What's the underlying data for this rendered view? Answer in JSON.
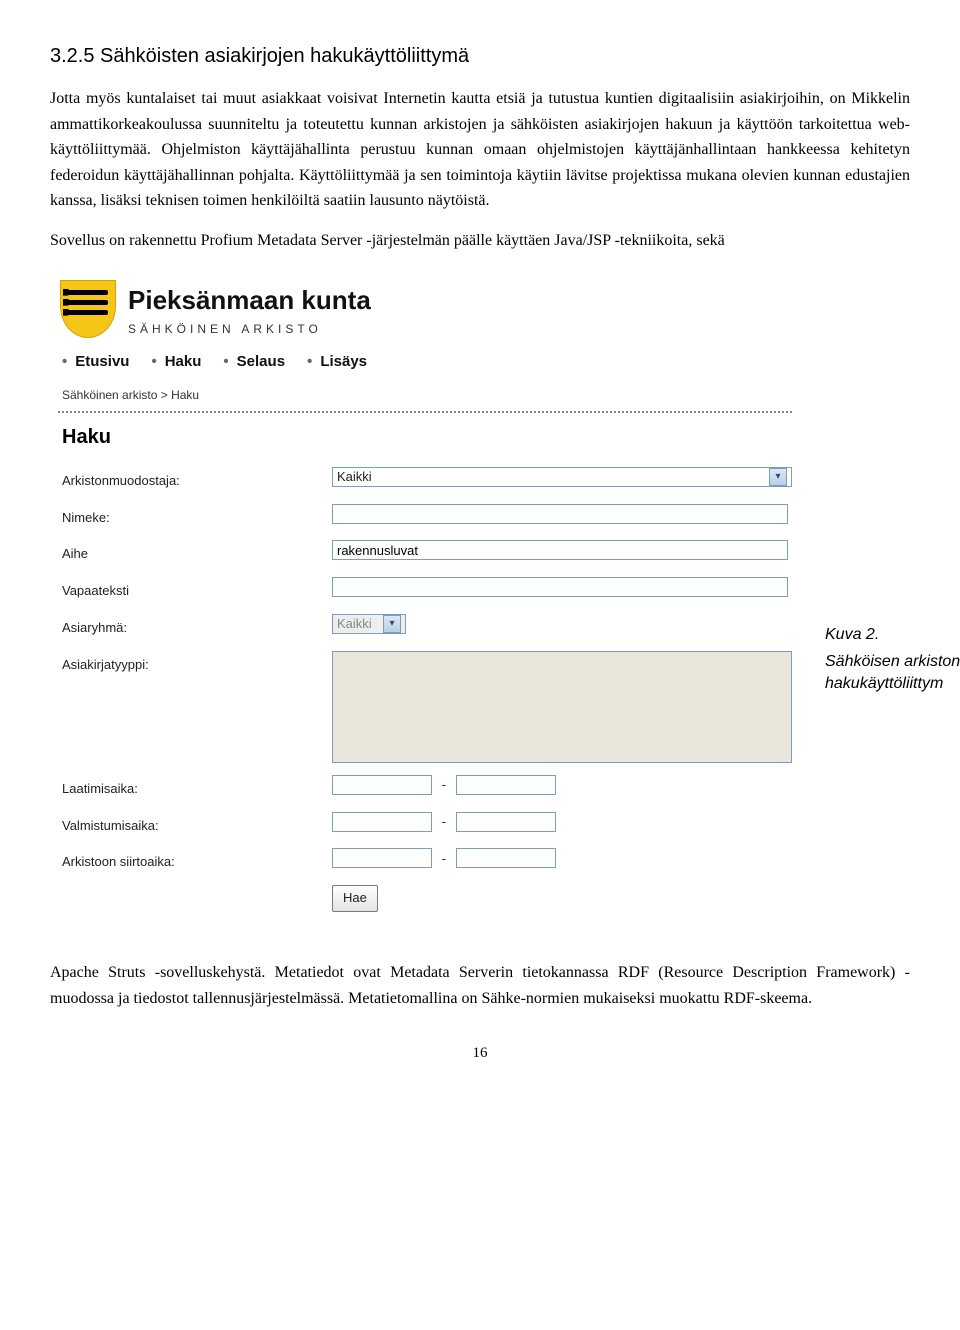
{
  "heading": "3.2.5 Sähköisten asiakirjojen hakukäyttöliittymä",
  "paragraphs": {
    "p1": "Jotta myös kuntalaiset tai muut asiakkaat voisivat Internetin kautta etsiä ja tutustua kuntien digitaalisiin asiakirjoihin, on Mikkelin ammattikorkeakoulussa suunniteltu ja toteutettu kunnan arkistojen ja sähköisten asiakirjojen hakuun ja käyttöön tarkoitettua web-käyttöliittymää. Ohjelmiston käyttäjähallinta perustuu kunnan omaan ohjelmistojen käyttäjänhallintaan hankkeessa kehitetyn federoidun käyttäjähallinnan pohjalta. Käyttöliittymää ja sen toimintoja käytiin lävitse projektissa mukana olevien kunnan edustajien kanssa, lisäksi teknisen toimen henkilöiltä saatiin lausunto näytöistä.",
    "p2": "Sovellus on rakennettu Profium Metadata Server -järjestelmän päälle käyttäen Java/JSP -tekniikoita, sekä",
    "p3": "Apache Struts -sovelluskehystä. Metatiedot ovat Metadata Serverin tietokannassa RDF (Resource Description Framework) -muodossa ja tiedostot tallennusjärjestelmässä. Metatietomallina on Sähke-normien mukaiseksi muokattu RDF-skeema."
  },
  "figure": {
    "title_big": "Pieksänmaan kunta",
    "title_sub": "SÄHKÖINEN ARKISTO",
    "nav": [
      "Etusivu",
      "Haku",
      "Selaus",
      "Lisäys"
    ],
    "breadcrumb": "Sähköinen arkisto > Haku",
    "section": "Haku",
    "fields": {
      "arkistonmuodostaja": {
        "label": "Arkistonmuodostaja:",
        "value": "Kaikki"
      },
      "nimeke": {
        "label": "Nimeke:",
        "value": ""
      },
      "aihe": {
        "label": "Aihe",
        "value": "rakennusluvat"
      },
      "vapaateksti": {
        "label": "Vapaateksti",
        "value": ""
      },
      "asiaryhma": {
        "label": "Asiaryhmä:",
        "value": "Kaikki"
      },
      "asiakirjatyyppi": {
        "label": "Asiakirjatyyppi:"
      },
      "laatimisaika": {
        "label": "Laatimisaika:"
      },
      "valmistumisaika": {
        "label": "Valmistumisaika:"
      },
      "arkistoon_siirtoaika": {
        "label": "Arkistoon siirtoaika:"
      }
    },
    "button": "Hae"
  },
  "caption": {
    "line1": "Kuva 2.",
    "line2": "Sähköisen arkiston hakukäyttöliittym"
  },
  "page_number": "16"
}
